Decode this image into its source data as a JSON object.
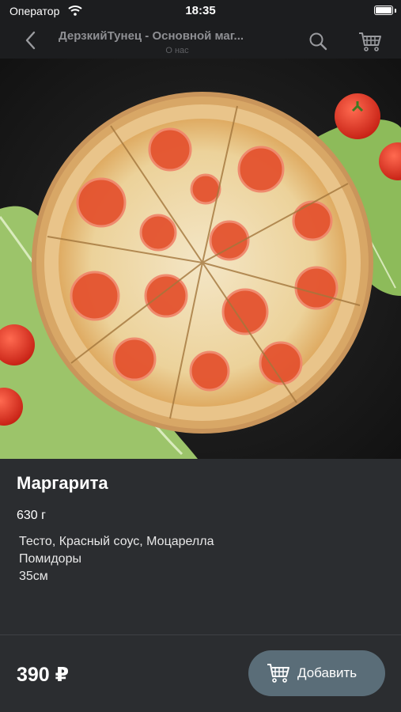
{
  "status_bar": {
    "carrier": "Оператор",
    "time": "18:35"
  },
  "nav": {
    "title": "ДерзкийТунец - Основной маг...",
    "subtitle": "О нас",
    "icons": [
      "chevron-left-icon",
      "search-icon",
      "cart-icon"
    ]
  },
  "product": {
    "name": "Маргарита",
    "weight": "630 г",
    "description_lines": [
      "Тесто, Красный соус, Моцарелла",
      "Помидоры",
      "35см"
    ],
    "price": "390 ₽"
  },
  "actions": {
    "add_label": "Добавить"
  },
  "colors": {
    "background": "#2b2d30",
    "bar": "#1c1d1f",
    "button": "#5a6d78"
  }
}
